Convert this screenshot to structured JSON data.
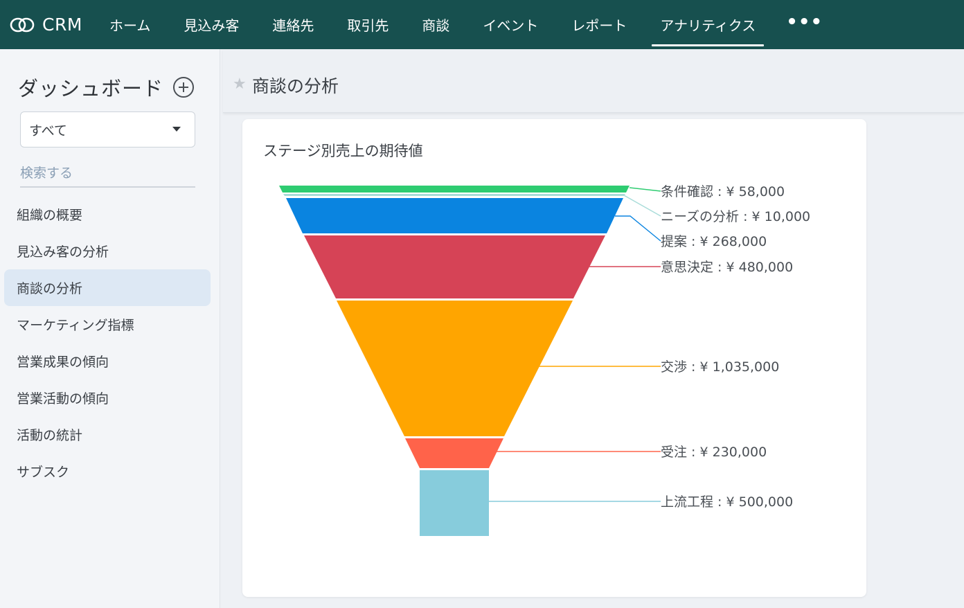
{
  "app": {
    "brand": "CRM",
    "logo_icon": "double-ring-logo-icon"
  },
  "nav": {
    "items": [
      {
        "label": "ホーム"
      },
      {
        "label": "見込み客"
      },
      {
        "label": "連絡先"
      },
      {
        "label": "取引先"
      },
      {
        "label": "商談"
      },
      {
        "label": "イベント"
      },
      {
        "label": "レポート"
      },
      {
        "label": "アナリティクス",
        "active": true
      }
    ],
    "more_label": "•••"
  },
  "sidebar": {
    "title": "ダッシュボード",
    "filter": {
      "selected": "すべて"
    },
    "search": {
      "placeholder": "検索する",
      "value": ""
    },
    "items": [
      {
        "label": "組織の概要"
      },
      {
        "label": "見込み客の分析"
      },
      {
        "label": "商談の分析",
        "active": true
      },
      {
        "label": "マーケティング指標"
      },
      {
        "label": "営業成果の傾向"
      },
      {
        "label": "営業活動の傾向"
      },
      {
        "label": "活動の統計"
      },
      {
        "label": "サブスク"
      }
    ]
  },
  "main": {
    "title": "商談の分析",
    "star_icon": "star-icon"
  },
  "card": {
    "title": "ステージ別売上の期待値"
  },
  "chart_data": {
    "type": "funnel",
    "title": "ステージ別売上の期待値",
    "stages": [
      {
        "name": "条件確認",
        "value": 58000,
        "label": "条件確認 : ¥ 58,000",
        "color": "#2ecc71"
      },
      {
        "name": "ニーズの分析",
        "value": 10000,
        "label": "ニーズの分析 : ¥ 10,000",
        "color": "#a8dcd9"
      },
      {
        "name": "提案",
        "value": 268000,
        "label": "提案 : ¥ 268,000",
        "color": "#0a84e0"
      },
      {
        "name": "意思決定",
        "value": 480000,
        "label": "意思決定 : ¥ 480,000",
        "color": "#d64356"
      },
      {
        "name": "交渉",
        "value": 1035000,
        "label": "交渉 : ¥ 1,035,000",
        "color": "#ffa500"
      },
      {
        "name": "受注",
        "value": 230000,
        "label": "受注 : ¥ 230,000",
        "color": "#ff634a"
      },
      {
        "name": "上流工程",
        "value": 500000,
        "label": "上流工程 : ¥ 500,000",
        "color": "#87ccdc"
      }
    ]
  }
}
